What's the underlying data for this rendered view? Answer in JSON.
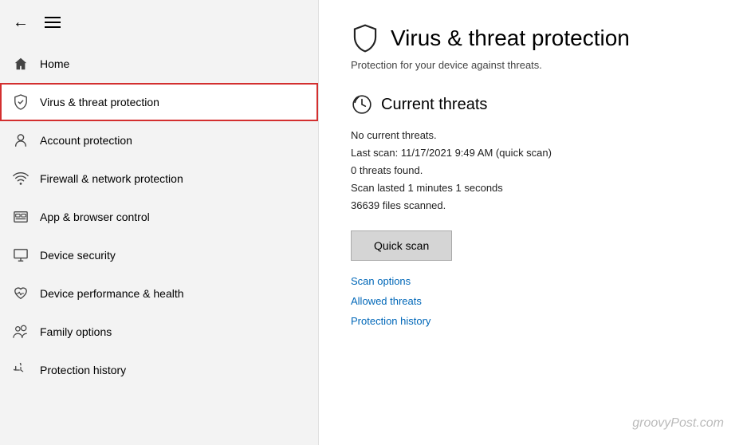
{
  "sidebar": {
    "back_label": "←",
    "items": [
      {
        "id": "home",
        "label": "Home",
        "icon": "house",
        "active": false
      },
      {
        "id": "virus",
        "label": "Virus & threat protection",
        "icon": "shield",
        "active": true
      },
      {
        "id": "account",
        "label": "Account protection",
        "icon": "person",
        "active": false
      },
      {
        "id": "firewall",
        "label": "Firewall & network protection",
        "icon": "wifi",
        "active": false
      },
      {
        "id": "app",
        "label": "App & browser control",
        "icon": "browser",
        "active": false
      },
      {
        "id": "device",
        "label": "Device security",
        "icon": "monitor",
        "active": false
      },
      {
        "id": "performance",
        "label": "Device performance & health",
        "icon": "heart",
        "active": false
      },
      {
        "id": "family",
        "label": "Family options",
        "icon": "family",
        "active": false
      },
      {
        "id": "history",
        "label": "Protection history",
        "icon": "history",
        "active": false
      }
    ]
  },
  "main": {
    "page_title": "Virus & threat protection",
    "page_subtitle": "Protection for your device against threats.",
    "section_title": "Current threats",
    "no_threats_text": "No current threats.",
    "last_scan_text": "Last scan: 11/17/2021 9:49 AM (quick scan)",
    "threats_found_text": "0 threats found.",
    "scan_duration_text": "Scan lasted 1 minutes 1 seconds",
    "files_scanned_text": "36639 files scanned.",
    "quick_scan_label": "Quick scan",
    "scan_options_label": "Scan options",
    "allowed_threats_label": "Allowed threats",
    "protection_history_label": "Protection history",
    "watermark": "groovyPost.com"
  }
}
